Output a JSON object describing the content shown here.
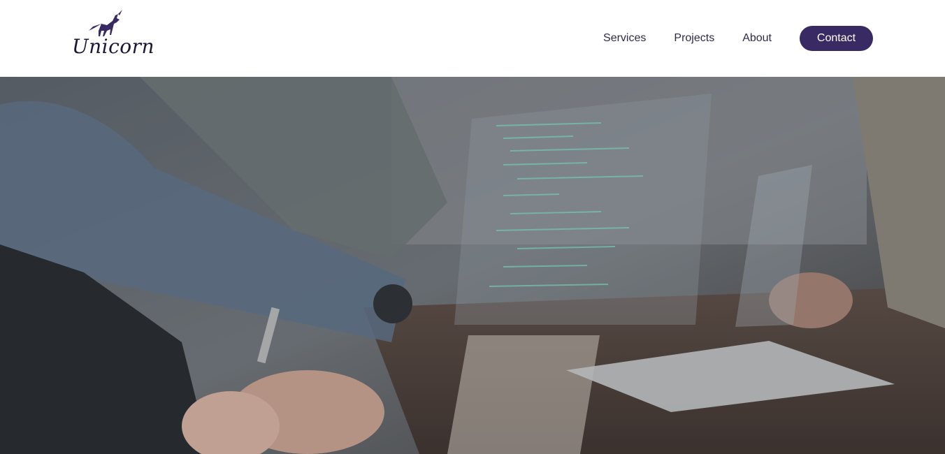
{
  "brand": {
    "name": "Unicorn",
    "logo_icon": "unicorn-icon",
    "color": "#1c1533"
  },
  "nav": {
    "items": [
      {
        "label": "Services"
      },
      {
        "label": "Projects"
      },
      {
        "label": "About"
      }
    ],
    "contact_label": "Contact"
  },
  "colors": {
    "accent": "#3a2a64",
    "nav_text": "#2f2a4a"
  },
  "hero": {
    "image": "team-working-with-holographic-code-screens-photo"
  }
}
